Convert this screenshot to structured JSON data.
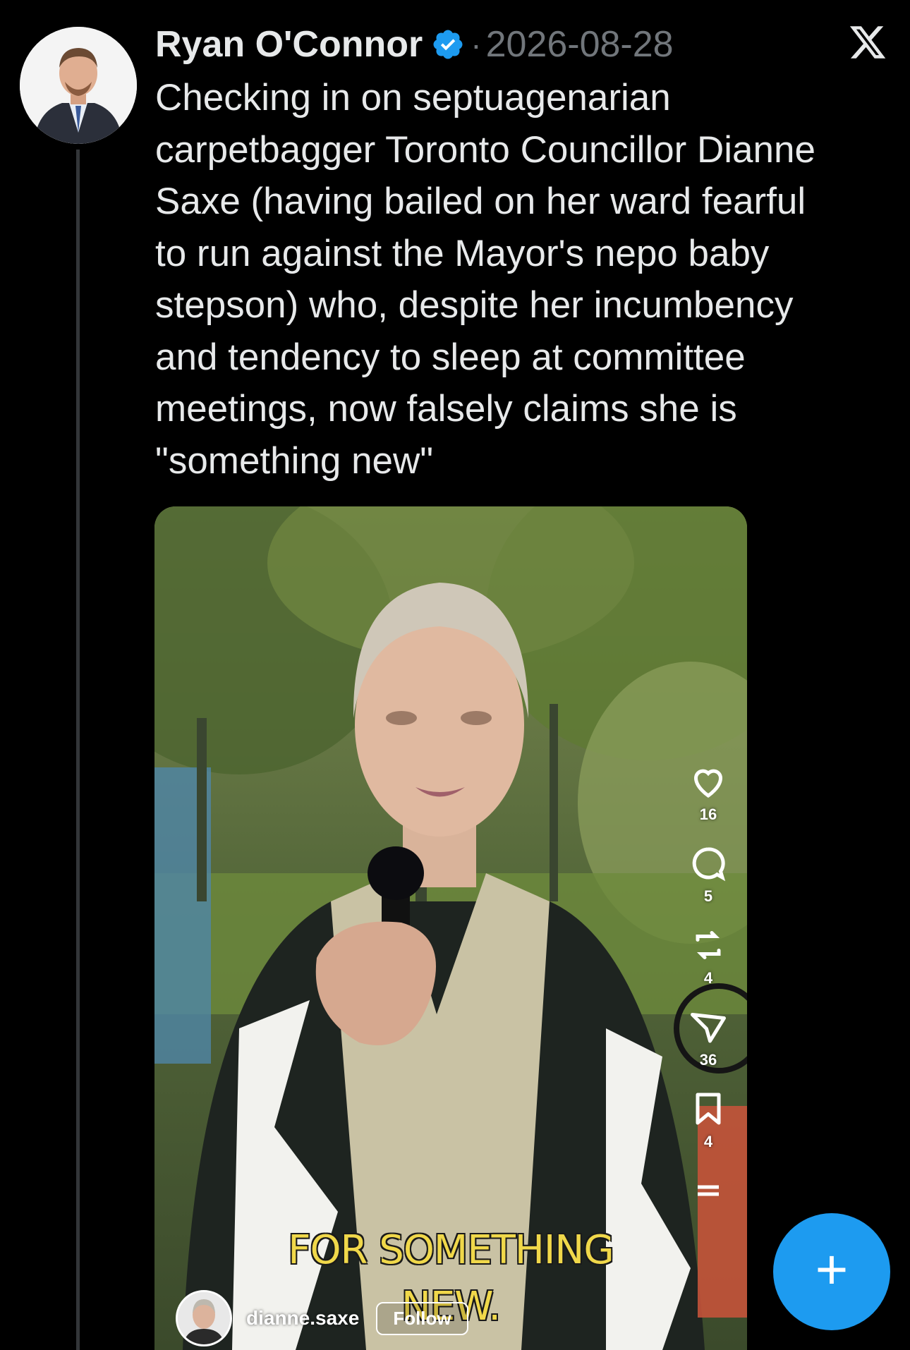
{
  "post": {
    "author_name": "Ryan O'Connor",
    "verified": true,
    "separator": "·",
    "date": "2026-08-28",
    "text": "Checking in on septuagenarian\ncarpetbagger Toronto Councillor Dianne\nSaxe (having bailed on her ward fearful\nto run against the Mayor's nepo baby\nstepson) who, despite her incumbency\nand tendency to sleep at committee\nmeetings, now falsely claims she is\n\"something new\""
  },
  "brand": {
    "logo": "x-logo-icon"
  },
  "media": {
    "type": "video-screenshot",
    "caption_line1": "FOR SOMETHING",
    "caption_line2": "NEW.",
    "handle": "dianne.saxe",
    "follow_label": "Follow",
    "actions": [
      {
        "icon": "heart-icon",
        "count": "16"
      },
      {
        "icon": "comment-icon",
        "count": "5"
      },
      {
        "icon": "repost-icon",
        "count": "4"
      },
      {
        "icon": "share-icon",
        "count": "36"
      },
      {
        "icon": "bookmark-icon",
        "count": "4"
      }
    ]
  },
  "fab": {
    "label": "+",
    "icon": "compose-plus-icon"
  },
  "colors": {
    "background": "#000000",
    "text": "#e7e9ea",
    "muted": "#71767b",
    "accent": "#1d9bf0",
    "caption": "#f0d84a"
  }
}
